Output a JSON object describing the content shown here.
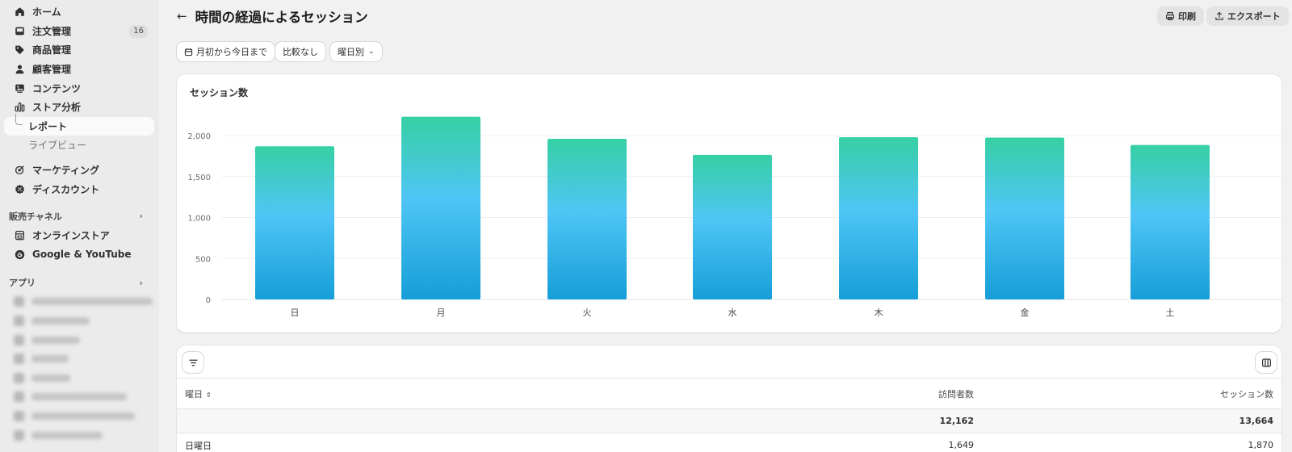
{
  "sidebar": {
    "nav": [
      {
        "label": "ホーム",
        "icon": "home-icon"
      },
      {
        "label": "注文管理",
        "icon": "inbox-icon",
        "badge": "16"
      },
      {
        "label": "商品管理",
        "icon": "tag-icon"
      },
      {
        "label": "顧客管理",
        "icon": "person-icon"
      },
      {
        "label": "コンテンツ",
        "icon": "image-icon"
      },
      {
        "label": "ストア分析",
        "icon": "bar-chart-icon"
      }
    ],
    "analytics_sub": [
      {
        "label": "レポート"
      },
      {
        "label": "ライブビュー"
      }
    ],
    "nav2": [
      {
        "label": "マーケティング",
        "icon": "target-icon"
      },
      {
        "label": "ディスカウント",
        "icon": "discount-icon"
      }
    ],
    "sales_channels": {
      "label": "販売チャネル",
      "items": [
        {
          "label": "オンラインストア",
          "icon": "store-icon"
        },
        {
          "label": "Google & YouTube",
          "icon": "google-icon"
        }
      ]
    },
    "apps": {
      "label": "アプリ"
    }
  },
  "header": {
    "title": "時間の経過によるセッション",
    "print_label": "印刷",
    "export_label": "エクスポート"
  },
  "filters": {
    "date_range": "月初から今日まで",
    "compare": "比較なし",
    "group_by": "曜日別"
  },
  "chart_data": {
    "type": "bar",
    "title": "セッション数",
    "categories": [
      "日",
      "月",
      "火",
      "水",
      "木",
      "金",
      "土"
    ],
    "values": [
      1870,
      2230,
      1960,
      1765,
      1980,
      1975,
      1885
    ],
    "ylim": [
      0,
      2500
    ],
    "yticks": [
      0,
      500,
      1000,
      1500,
      2000
    ],
    "ytick_labels": [
      "0",
      "500",
      "1,000",
      "1,500",
      "2,000"
    ],
    "grid": true,
    "colors": {
      "top": "#36d0a4",
      "mid": "#4fc5f5",
      "bottom": "#169ed8"
    }
  },
  "table": {
    "columns": [
      "曜日",
      "訪問者数",
      "セッション数"
    ],
    "total": {
      "visitors": "12,162",
      "sessions": "13,664"
    },
    "rows": [
      {
        "day": "日曜日",
        "visitors": "1,649",
        "sessions": "1,870"
      }
    ]
  }
}
